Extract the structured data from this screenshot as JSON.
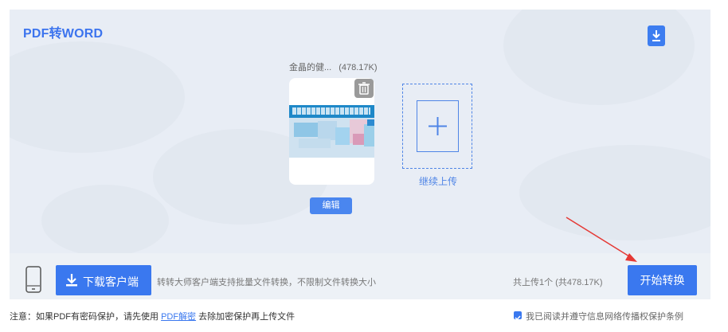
{
  "header": {
    "title": "PDF转WORD"
  },
  "file": {
    "name": "金晶的健...",
    "size": "(478.17K)"
  },
  "actions": {
    "edit_label": "编辑",
    "continue_upload_label": "继续上传",
    "download_client_label": "下载客户端",
    "client_tip": "转转大师客户端支持批量文件转换，不限制文件转换大小",
    "summary": "共上传1个 (共478.17K)",
    "start_label": "开始转换"
  },
  "footer": {
    "notice_prefix": "注意：如果PDF有密码保护，请先使用",
    "notice_link": "PDF解密",
    "notice_suffix": "去除加密保护再上传文件",
    "agree_checked": true,
    "agree_label": "我已阅读并遵守信息网络传播权保护条例"
  },
  "colors": {
    "accent": "#3a78ef",
    "annotation_arrow": "#e53935"
  }
}
